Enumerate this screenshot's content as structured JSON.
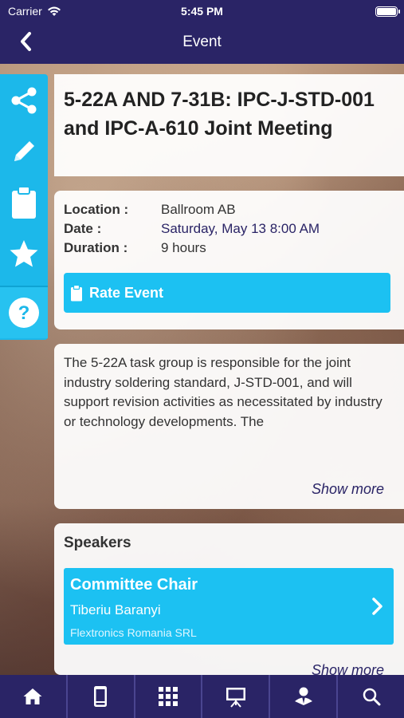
{
  "status_bar": {
    "carrier": "Carrier",
    "time": "5:45 PM"
  },
  "nav": {
    "title": "Event"
  },
  "event": {
    "title": "5-22A AND 7-31B: IPC-J-STD-001 and IPC-A-610 Joint Meeting",
    "location_label": "Location :",
    "location": "Ballroom AB",
    "date_label": "Date :",
    "date": "Saturday, May 13 8:00 AM",
    "duration_label": "Duration :",
    "duration": "9 hours",
    "rate_label": "Rate Event",
    "description": "The 5-22A task group is responsible for the joint industry soldering standard, J-STD-001, and will support revision activities as necessitated by industry or technology developments. The",
    "show_more": "Show more"
  },
  "speakers": {
    "heading": "Speakers",
    "items": [
      {
        "role": "Committee Chair",
        "name": "Tiberiu Baranyi",
        "org": "Flextronics Romania SRL"
      }
    ],
    "show_more": "Show more"
  },
  "sidebar": [
    "share-icon",
    "pencil-icon",
    "clipboard-icon",
    "star-icon",
    "help-icon"
  ],
  "tabbar": [
    "home-icon",
    "phone-icon",
    "grid-icon",
    "presentation-icon",
    "person-icon",
    "search-icon"
  ],
  "colors": {
    "nav": "#2a2466",
    "accent": "#1cc1f2"
  }
}
